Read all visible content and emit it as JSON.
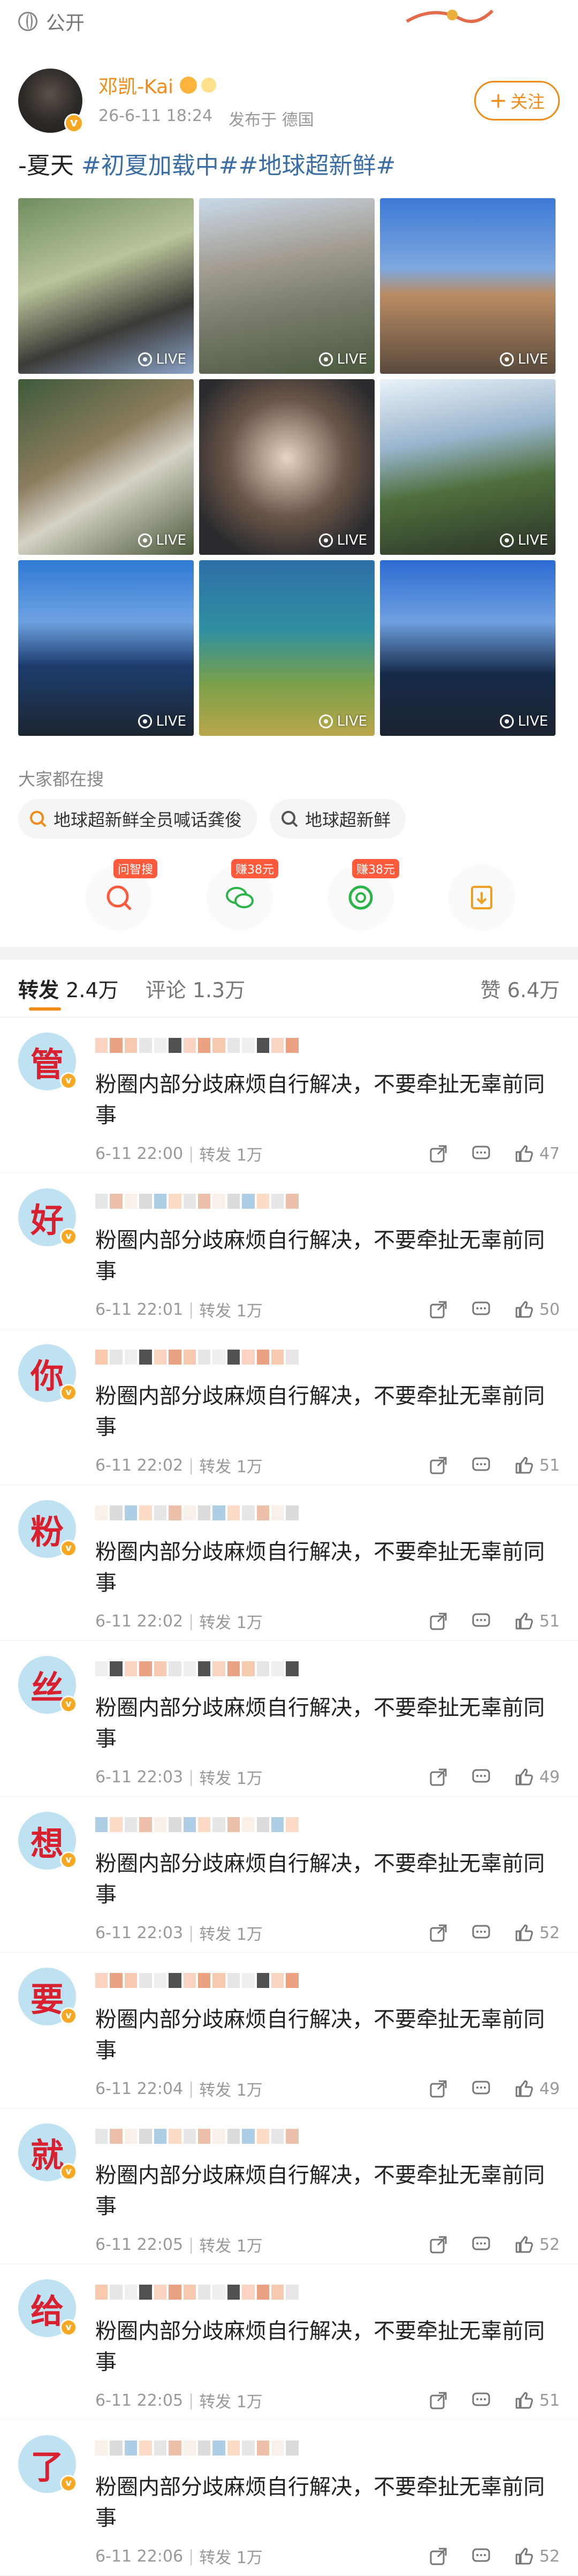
{
  "topbar": {
    "visibility": "公开"
  },
  "post": {
    "author": "邓凯-Kai",
    "time": "26-6-11 18:24",
    "location": "发布于 德国",
    "follow_label": "关注",
    "text_prefix": "-夏天 ",
    "tags": "#初夏加载中##地球超新鲜#",
    "live_label": "LIVE"
  },
  "others_search": {
    "title": "大家都在搜",
    "chips": [
      "地球超新鲜全员喊话龚俊",
      "地球超新鲜"
    ]
  },
  "actions": {
    "tags": [
      "问智搜",
      "赚38元",
      "赚38元"
    ]
  },
  "tabs": {
    "repost": "转发",
    "repost_count": "2.4万",
    "comment": "评论",
    "comment_count": "1.3万",
    "like": "赞",
    "like_count": "6.4万"
  },
  "comments": [
    {
      "avatar_char": "管",
      "text": "粉圈内部分歧麻烦自行解决，不要牵扯无辜前同事",
      "time": "6-11 22:00",
      "repost": "转发 1万",
      "likes": "47"
    },
    {
      "avatar_char": "好",
      "text": "粉圈内部分歧麻烦自行解决，不要牵扯无辜前同事",
      "time": "6-11 22:01",
      "repost": "转发 1万",
      "likes": "50"
    },
    {
      "avatar_char": "你",
      "text": "粉圈内部分歧麻烦自行解决，不要牵扯无辜前同事",
      "time": "6-11 22:02",
      "repost": "转发 1万",
      "likes": "51"
    },
    {
      "avatar_char": "粉",
      "text": "粉圈内部分歧麻烦自行解决，不要牵扯无辜前同事",
      "time": "6-11 22:02",
      "repost": "转发 1万",
      "likes": "51"
    },
    {
      "avatar_char": "丝",
      "text": "粉圈内部分歧麻烦自行解决，不要牵扯无辜前同事",
      "time": "6-11 22:03",
      "repost": "转发 1万",
      "likes": "49"
    },
    {
      "avatar_char": "想",
      "text": "粉圈内部分歧麻烦自行解决，不要牵扯无辜前同事",
      "time": "6-11 22:03",
      "repost": "转发 1万",
      "likes": "52"
    },
    {
      "avatar_char": "要",
      "text": "粉圈内部分歧麻烦自行解决，不要牵扯无辜前同事",
      "time": "6-11 22:04",
      "repost": "转发 1万",
      "likes": "49"
    },
    {
      "avatar_char": "就",
      "text": "粉圈内部分歧麻烦自行解决，不要牵扯无辜前同事",
      "time": "6-11 22:05",
      "repost": "转发 1万",
      "likes": "52"
    },
    {
      "avatar_char": "给",
      "text": "粉圈内部分歧麻烦自行解决，不要牵扯无辜前同事",
      "time": "6-11 22:05",
      "repost": "转发 1万",
      "likes": "51"
    },
    {
      "avatar_char": "了",
      "text": "粉圈内部分歧麻烦自行解决，不要牵扯无辜前同事",
      "time": "6-11 22:06",
      "repost": "转发 1万",
      "likes": "52"
    }
  ]
}
